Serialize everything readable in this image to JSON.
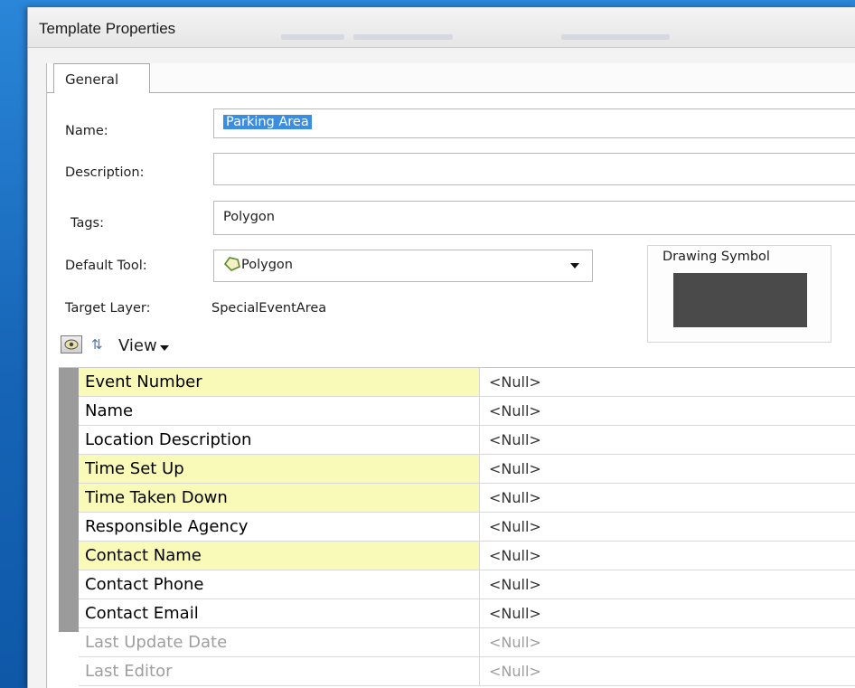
{
  "window": {
    "title": "Template Properties"
  },
  "tabs": [
    {
      "label": "General"
    }
  ],
  "form": {
    "name_label": "Name:",
    "name_value": "Parking Area",
    "description_label": "Description:",
    "description_value": "",
    "tags_label": "Tags:",
    "tags_value": "Polygon",
    "default_tool_label": "Default Tool:",
    "default_tool_value": "Polygon",
    "target_layer_label": "Target Layer:",
    "target_layer_value": "SpecialEventArea"
  },
  "drawing_symbol": {
    "label": "Drawing Symbol",
    "fill_color": "#4a4a4a"
  },
  "toolbar": {
    "view_label": "View"
  },
  "attributes": [
    {
      "name": "Event Number",
      "value": "<Null>",
      "required": true,
      "editable": true
    },
    {
      "name": "Name",
      "value": "<Null>",
      "required": false,
      "editable": true
    },
    {
      "name": "Location Description",
      "value": "<Null>",
      "required": false,
      "editable": true
    },
    {
      "name": "Time Set Up",
      "value": "<Null>",
      "required": true,
      "editable": true
    },
    {
      "name": "Time Taken Down",
      "value": "<Null>",
      "required": true,
      "editable": true
    },
    {
      "name": "Responsible Agency",
      "value": "<Null>",
      "required": false,
      "editable": true
    },
    {
      "name": "Contact Name",
      "value": "<Null>",
      "required": true,
      "editable": true
    },
    {
      "name": "Contact Phone",
      "value": "<Null>",
      "required": false,
      "editable": true
    },
    {
      "name": "Contact Email",
      "value": "<Null>",
      "required": false,
      "editable": true
    },
    {
      "name": "Last Update Date",
      "value": "<Null>",
      "required": false,
      "editable": false
    },
    {
      "name": "Last Editor",
      "value": "<Null>",
      "required": false,
      "editable": false
    }
  ],
  "colors": {
    "required_highlight": "#fafab8",
    "selection": "#3a8de0",
    "desktop": "#1b6fc0"
  }
}
